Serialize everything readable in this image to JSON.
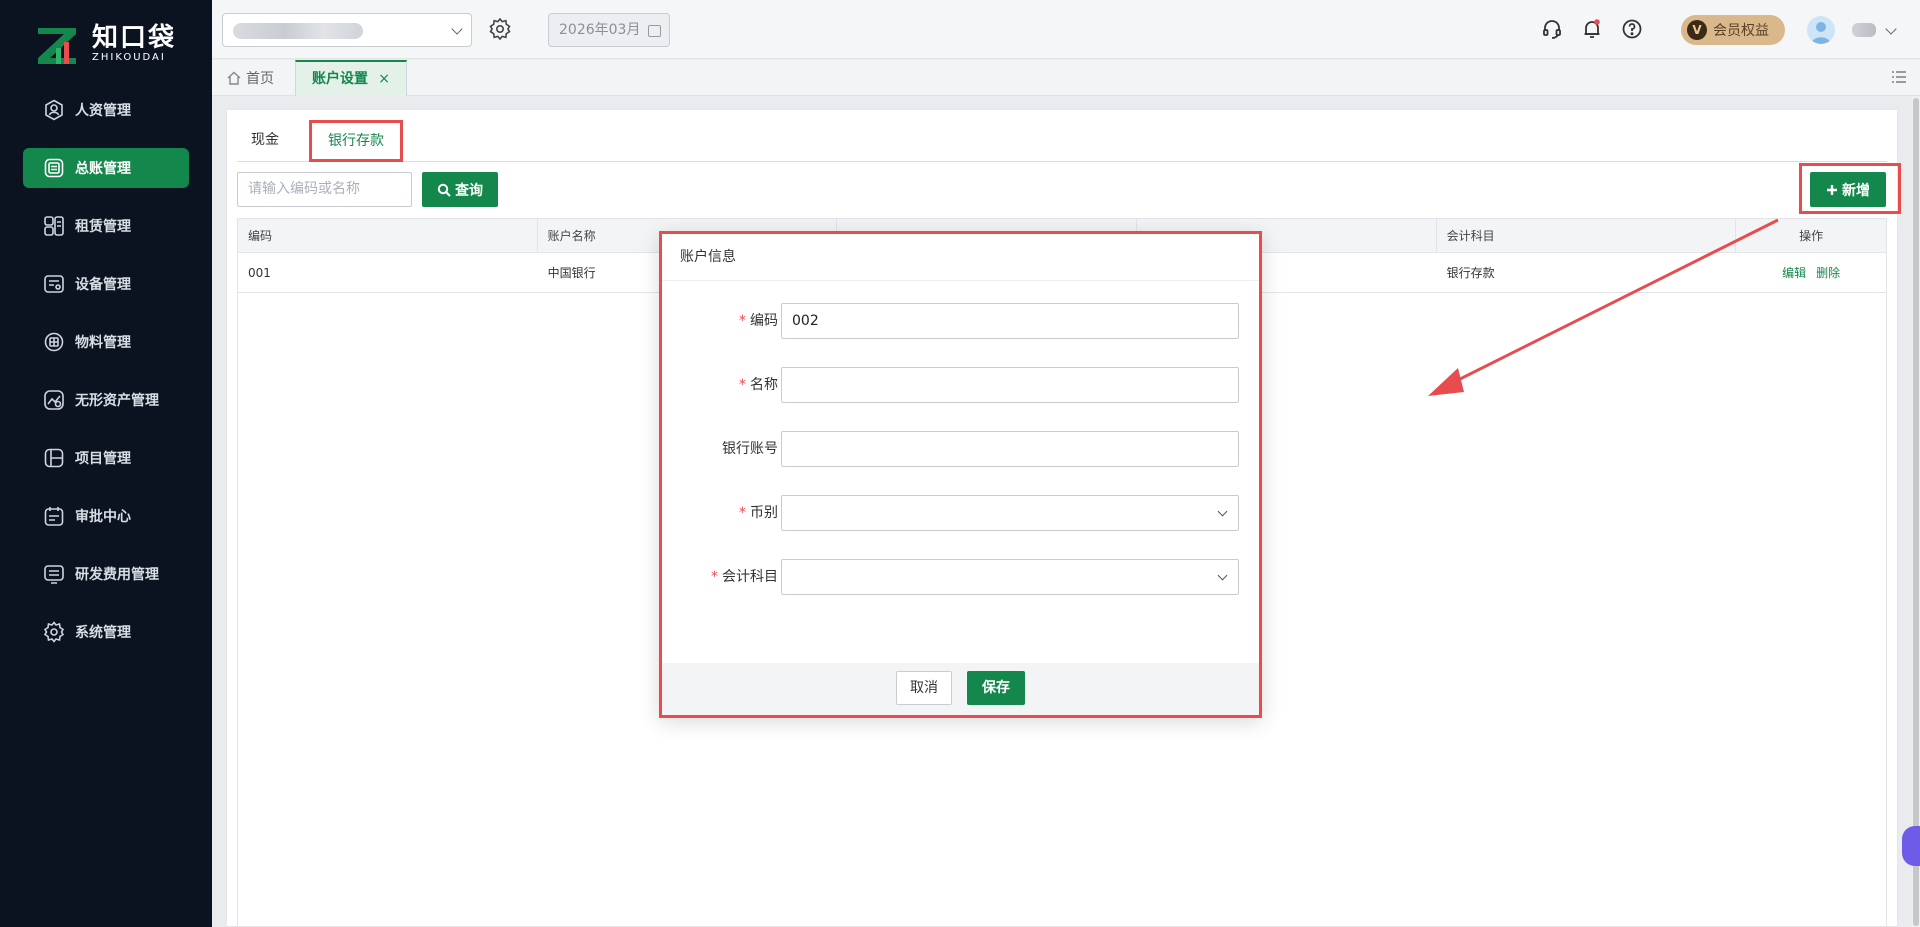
{
  "brand": {
    "name_cn": "知口袋",
    "name_en": "ZHIKOUDAI"
  },
  "sidebar": {
    "items": [
      {
        "label": "人资管理",
        "icon": "person-circle-icon",
        "active": false
      },
      {
        "label": "总账管理",
        "icon": "ledger-icon",
        "active": true
      },
      {
        "label": "租赁管理",
        "icon": "lease-icon",
        "active": false
      },
      {
        "label": "设备管理",
        "icon": "device-icon",
        "active": false
      },
      {
        "label": "物料管理",
        "icon": "material-icon",
        "active": false
      },
      {
        "label": "无形资产管理",
        "icon": "intangible-asset-icon",
        "active": false
      },
      {
        "label": "项目管理",
        "icon": "project-icon",
        "active": false
      },
      {
        "label": "审批中心",
        "icon": "approval-icon",
        "active": false
      },
      {
        "label": "研发费用管理",
        "icon": "rd-expense-icon",
        "active": false
      },
      {
        "label": "系统管理",
        "icon": "gear-icon",
        "active": false
      }
    ]
  },
  "topbar": {
    "period": "2026年03月",
    "member_label": "会员权益",
    "member_badge_letter": "V"
  },
  "tabs": {
    "home": "首页",
    "active": "账户设置",
    "close_glyph": "×"
  },
  "subtabs": {
    "cash": "现金",
    "bank": "银行存款"
  },
  "toolbar": {
    "search_placeholder": "请输入编码或名称",
    "query_label": "查询",
    "add_label": "新增"
  },
  "table": {
    "columns": [
      "编码",
      "账户名称",
      "",
      "",
      "会计科目",
      "操作"
    ],
    "rows": [
      {
        "code": "001",
        "name": "中国银行",
        "c3": "",
        "c4": "",
        "subject": "银行存款",
        "edit": "编辑",
        "delete": "删除"
      }
    ]
  },
  "modal": {
    "title": "账户信息",
    "fields": {
      "code": {
        "label": "编码",
        "required": true,
        "value": "002"
      },
      "name": {
        "label": "名称",
        "required": true,
        "value": ""
      },
      "bank_account": {
        "label": "银行账号",
        "required": false,
        "value": ""
      },
      "currency": {
        "label": "币别",
        "required": true,
        "value": ""
      },
      "subject": {
        "label": "会计科目",
        "required": true,
        "value": ""
      }
    },
    "required_mark": "*",
    "cancel_label": "取消",
    "save_label": "保存"
  },
  "colors": {
    "brand_green": "#14874c",
    "sidebar_bg": "#0b1320",
    "highlight_red": "#e84c4f"
  }
}
